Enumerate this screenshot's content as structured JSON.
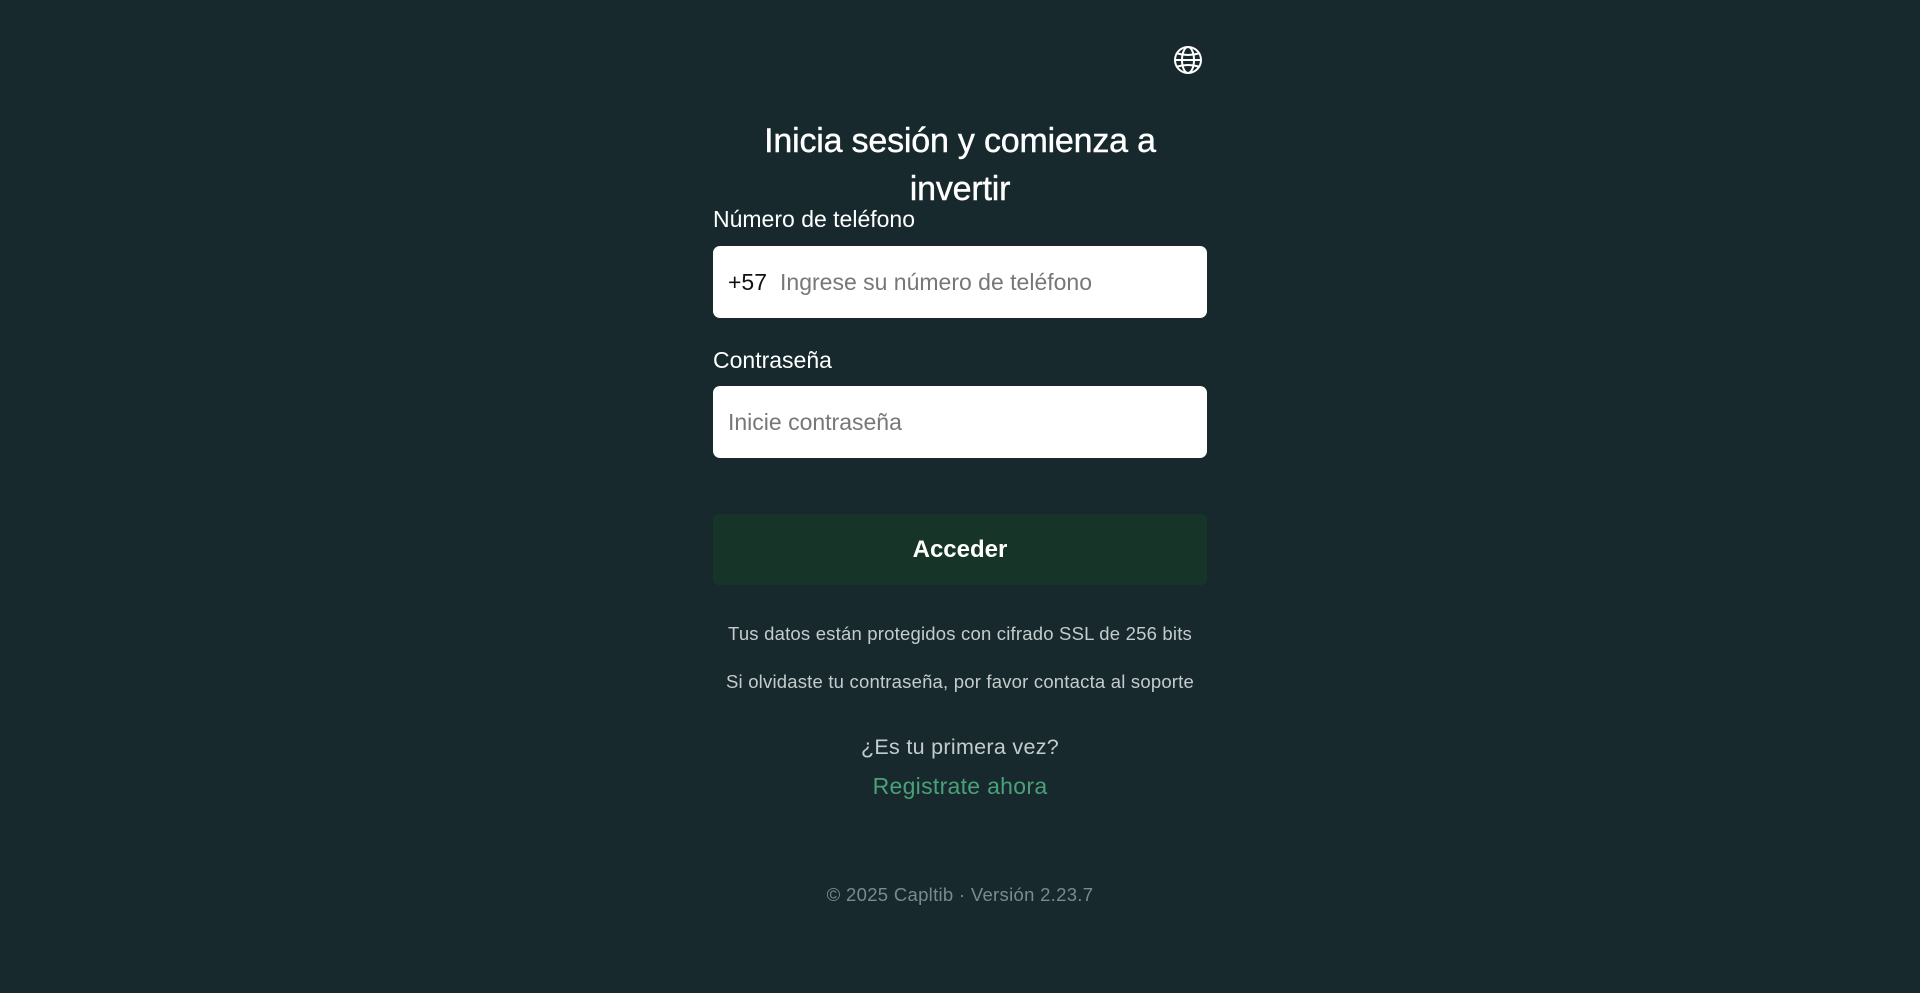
{
  "header": {
    "language_icon": "globe-icon"
  },
  "login": {
    "title": "Inicia sesión y comienza a invertir",
    "phone_label": "Número de teléfono",
    "phone_prefix": "+57",
    "phone_value": "",
    "phone_placeholder": "Ingrese su número de teléfono",
    "password_label": "Contraseña",
    "password_value": "",
    "password_placeholder": "Inicie contraseña",
    "submit_label": "Acceder",
    "ssl_note": "Tus datos están protegidos con cifrado SSL de 256 bits",
    "forgot_note": "Si olvidaste tu contraseña, por favor contacta al soporte",
    "first_time_text": "¿Es tu primera vez?",
    "register_link": "Registrate ahora"
  },
  "footer": {
    "text": "© 2025 Capltib · Versión 2.23.7"
  },
  "colors": {
    "background": "#17292d",
    "button_bg": "#163528",
    "link": "#4aa079",
    "muted_text": "#c4cccd",
    "footer_text": "#7d898b"
  }
}
